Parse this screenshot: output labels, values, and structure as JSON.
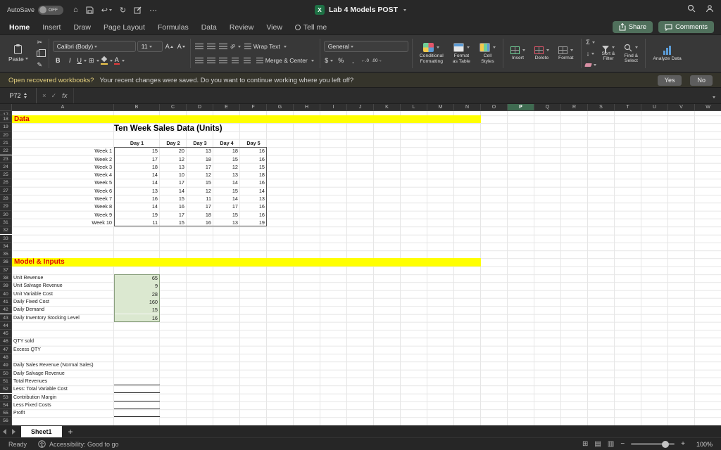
{
  "titlebar": {
    "autosave_label": "AutoSave",
    "autosave_state": "OFF",
    "doc_title": "Lab 4 Models POST"
  },
  "ribbon": {
    "tabs": [
      "Home",
      "Insert",
      "Draw",
      "Page Layout",
      "Formulas",
      "Data",
      "Review",
      "View",
      "Tell me"
    ],
    "active_tab": "Home",
    "share_label": "Share",
    "comments_label": "Comments",
    "clipboard": {
      "paste_label": "Paste"
    },
    "font": {
      "name": "Calibri (Body)",
      "size": "11"
    },
    "alignment": {
      "wrap_label": "Wrap Text",
      "merge_label": "Merge & Center"
    },
    "number": {
      "format": "General"
    },
    "styles": {
      "conditional_1": "Conditional",
      "conditional_2": "Formatting",
      "table_1": "Format",
      "table_2": "as Table",
      "cells_1": "Cell",
      "cells_2": "Styles"
    },
    "cells": {
      "insert": "Insert",
      "delete": "Delete",
      "format": "Format"
    },
    "editing": {
      "sort_1": "Sort &",
      "sort_2": "Filter",
      "find_1": "Find &",
      "find_2": "Select",
      "analyze_label": "Analyze Data"
    }
  },
  "icons": {
    "home": "⌂",
    "undo": "↩",
    "redo": "↻",
    "more": "⋯",
    "cut": "✂",
    "format_painter": "✎",
    "borders": "⊞",
    "bold": "B",
    "italic": "I",
    "underline": "U",
    "orientation": "ab",
    "currency": "$",
    "percent": "%",
    "comma": ",",
    "increase_decimal": "←.0",
    "decrease_decimal": ".00→",
    "autosum": "Σ",
    "fill_down": "↓",
    "excel_logo": "X",
    "cancel": "×",
    "enter": "✓",
    "view_normal": "⊞",
    "view_layout": "▤",
    "view_break": "▥",
    "minus": "−",
    "plus": "+"
  },
  "notification": {
    "question": "Open recovered workbooks?",
    "message": "Your recent changes were saved. Do you want to continue working where you left off?",
    "yes_label": "Yes",
    "no_label": "No"
  },
  "formula_bar": {
    "cell_ref": "P72",
    "fx_label": "fx"
  },
  "grid": {
    "columns": [
      "A",
      "B",
      "C",
      "D",
      "E",
      "F",
      "G",
      "H",
      "I",
      "J",
      "K",
      "L",
      "M",
      "N",
      "O",
      "P",
      "Q",
      "R",
      "S",
      "T",
      "U",
      "V",
      "W"
    ],
    "selected_column": "P",
    "rows_start": 17,
    "rows_end": 56
  },
  "sheet_content": {
    "section1_title": "Data",
    "table_title": "Ten Week Sales Data (Units)",
    "day_headers": [
      "Day 1",
      "Day 2",
      "Day 3",
      "Day 4",
      "Day 5"
    ],
    "weeks": [
      {
        "label": "Week 1",
        "values": [
          15,
          20,
          13,
          18,
          16
        ]
      },
      {
        "label": "Week 2",
        "values": [
          17,
          12,
          18,
          15,
          16
        ]
      },
      {
        "label": "Week 3",
        "values": [
          18,
          13,
          17,
          12,
          15
        ]
      },
      {
        "label": "Week 4",
        "values": [
          14,
          10,
          12,
          13,
          18
        ]
      },
      {
        "label": "Week 5",
        "values": [
          14,
          17,
          15,
          14,
          16
        ]
      },
      {
        "label": "Week 6",
        "values": [
          13,
          14,
          12,
          15,
          14
        ]
      },
      {
        "label": "Week 7",
        "values": [
          16,
          15,
          11,
          14,
          13
        ]
      },
      {
        "label": "Week 8",
        "values": [
          14,
          16,
          17,
          17,
          16
        ]
      },
      {
        "label": "Week 9",
        "values": [
          19,
          17,
          18,
          15,
          16
        ]
      },
      {
        "label": "Week 10",
        "values": [
          11,
          15,
          16,
          13,
          19
        ]
      }
    ],
    "section2_title": "Model & Inputs",
    "inputs": [
      {
        "row": 38,
        "label": "Unit Revenue",
        "value": 65
      },
      {
        "row": 39,
        "label": "Unit Salvage Revenue",
        "value": 9
      },
      {
        "row": 40,
        "label": "Unit Variable Cost",
        "value": 28
      },
      {
        "row": 41,
        "label": "Daily Fixed Cost",
        "value": 160
      },
      {
        "row": 42,
        "label": "Daily Demand",
        "value": 15
      },
      {
        "row": 43,
        "label": "Daily Inventory Stocking Level",
        "value": 16
      }
    ],
    "output_labels": [
      {
        "row": 46,
        "label": "QTY sold",
        "underline": false
      },
      {
        "row": 47,
        "label": "Excess QTY",
        "underline": false
      },
      {
        "row": 49,
        "label": "Daily Sales Revenue (Normal Sales)",
        "underline": false
      },
      {
        "row": 50,
        "label": "Daily Salvage Revenue",
        "underline": false
      },
      {
        "row": 51,
        "label": "Total Revenues",
        "underline": true
      },
      {
        "row": 52,
        "label": "Less: Total Variable Cost",
        "underline": true
      },
      {
        "row": 53,
        "label": "Contribution Margin",
        "underline": true
      },
      {
        "row": 54,
        "label": "Less Fixed Costs",
        "underline": true
      },
      {
        "row": 55,
        "label": "Profit",
        "underline": true
      }
    ]
  },
  "sheet_tabs": {
    "active": "Sheet1"
  },
  "status_bar": {
    "ready": "Ready",
    "accessibility": "Accessibility: Good to go",
    "zoom": "100%"
  },
  "colors": {
    "accent_green": "#1e7145",
    "selected_header_green": "#3f6b51",
    "highlight_yellow": "#ffff00",
    "section_title_red": "#e00000",
    "input_cell_green": "#dbe8d0"
  }
}
